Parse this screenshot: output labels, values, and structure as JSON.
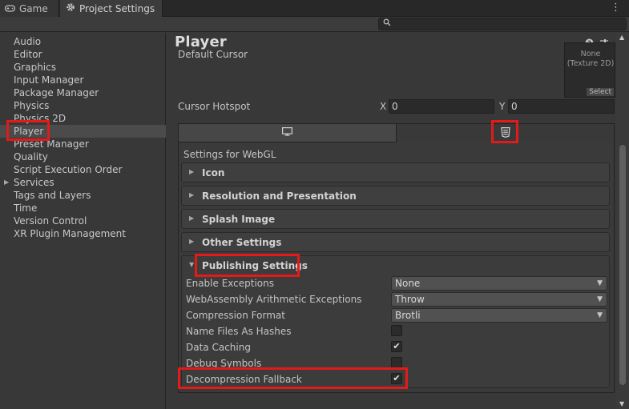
{
  "tabs": {
    "game_label": "Game",
    "game_icon": "gamepad-icon",
    "settings_label": "Project Settings",
    "settings_icon": "gear-icon"
  },
  "search": {
    "placeholder": "",
    "icon": "search-icon"
  },
  "sidebar": {
    "items": [
      {
        "label": "Audio"
      },
      {
        "label": "Editor"
      },
      {
        "label": "Graphics"
      },
      {
        "label": "Input Manager"
      },
      {
        "label": "Package Manager"
      },
      {
        "label": "Physics"
      },
      {
        "label": "Physics 2D"
      },
      {
        "label": "Player",
        "selected": true
      },
      {
        "label": "Preset Manager"
      },
      {
        "label": "Quality"
      },
      {
        "label": "Script Execution Order"
      },
      {
        "label": "Services",
        "expandable": true
      },
      {
        "label": "Tags and Layers"
      },
      {
        "label": "Time"
      },
      {
        "label": "Version Control"
      },
      {
        "label": "XR Plugin Management"
      }
    ]
  },
  "main": {
    "title": "Player",
    "header_icons": [
      "help-icon",
      "preset-icon",
      "settings-icon"
    ],
    "default_cursor_label": "Default Cursor",
    "cursor_value_line1": "None",
    "cursor_value_line2": "(Texture 2D)",
    "cursor_select": "Select",
    "cursor_hotspot_label": "Cursor Hotspot",
    "x_label": "X",
    "x_value": "0",
    "y_label": "Y",
    "y_value": "0",
    "platform_tabs": [
      "desktop-monitor-icon",
      "html5-webgl-icon"
    ],
    "settings_for": "Settings for WebGL",
    "sections": {
      "icon": "Icon",
      "resolution": "Resolution and Presentation",
      "splash": "Splash Image",
      "other": "Other Settings",
      "publishing": "Publishing Settings"
    },
    "publishing": {
      "enable_exceptions_label": "Enable Exceptions",
      "enable_exceptions_value": "None",
      "wasm_arith_label": "WebAssembly Arithmetic Exceptions",
      "wasm_arith_value": "Throw",
      "compression_label": "Compression Format",
      "compression_value": "Brotli",
      "name_files_label": "Name Files As Hashes",
      "name_files_checked": false,
      "data_caching_label": "Data Caching",
      "data_caching_checked": true,
      "debug_symbols_label": "Debug Symbols",
      "debug_symbols_checked": false,
      "decompression_label": "Decompression Fallback",
      "decompression_checked": true
    }
  },
  "colors": {
    "highlight": "#e21a1a",
    "background": "#383838",
    "selected_row": "#4b4b4b"
  }
}
